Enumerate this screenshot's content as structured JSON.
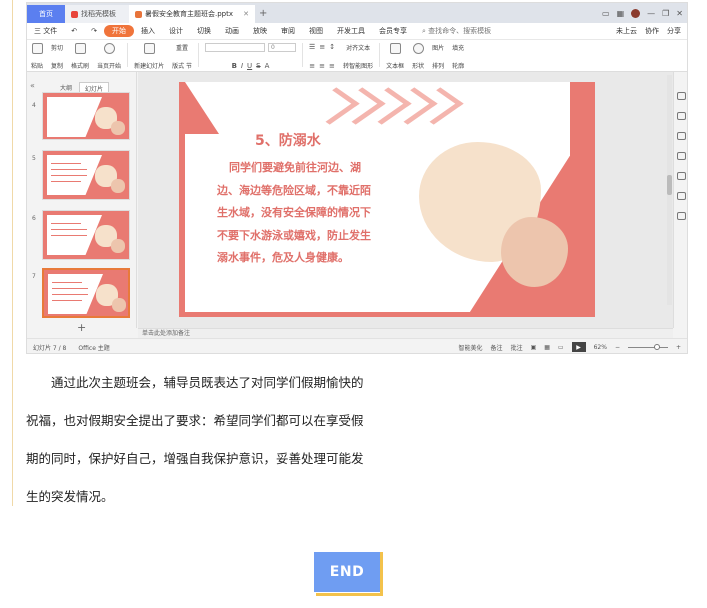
{
  "tabs": [
    {
      "label": "首页"
    },
    {
      "label": "找稻壳模板"
    },
    {
      "label": "暑假安全教育主题班会.pptx"
    }
  ],
  "menu": {
    "file": "三 文件",
    "items": [
      "开始",
      "插入",
      "设计",
      "切换",
      "动画",
      "放映",
      "审阅",
      "视图",
      "开发工具",
      "会员专享"
    ],
    "search": "查找命令、搜索模板",
    "right": [
      "未上云",
      "协作",
      "分享"
    ]
  },
  "ribbon": {
    "paste": "粘贴",
    "cut": "剪切",
    "copy": "复制",
    "format_painter": "格式刷",
    "play_from_current": "当页开始",
    "new_slide": "新建幻灯片",
    "layout": "版式",
    "section": "节",
    "reset": "重置",
    "font_size": "0",
    "text_box": "文本框",
    "shape": "形状",
    "arrange": "排列",
    "picture": "图片",
    "fill": "填充",
    "outline": "轮廓",
    "align_text": "对齐文本",
    "smart_art": "转智能图形"
  },
  "side_panel": {
    "tab_outline": "大纲",
    "tab_slides": "幻灯片",
    "slide_numbers": [
      "4",
      "5",
      "6",
      "7"
    ]
  },
  "slide": {
    "title": "5、防溺水",
    "body": "同学们要避免前往河边、湖边、海边等危险区域，不靠近陌生水域，没有安全保障的情况下不要下水游泳或嬉戏，防止发生溺水事件，危及人身健康。",
    "colors": {
      "primary": "#e97a72",
      "cream": "#f6e1cb",
      "tan": "#edc5ad"
    }
  },
  "notes_placeholder": "单击此处添加备注",
  "status": {
    "slide_info": "幻灯片 7 / 8",
    "theme": "Office 主题",
    "smart_beautify": "智能美化",
    "notes": "备注",
    "comments": "批注",
    "zoom": "62%"
  },
  "article": {
    "paragraph": "通过此次主题班会，辅导员既表达了对同学们假期愉快的祝福，也对假期安全提出了要求：希望同学们都可以在享受假期的同时，保护好自己，增强自我保护意识，妥善处理可能发生的突发情况。"
  },
  "end_label": "END"
}
